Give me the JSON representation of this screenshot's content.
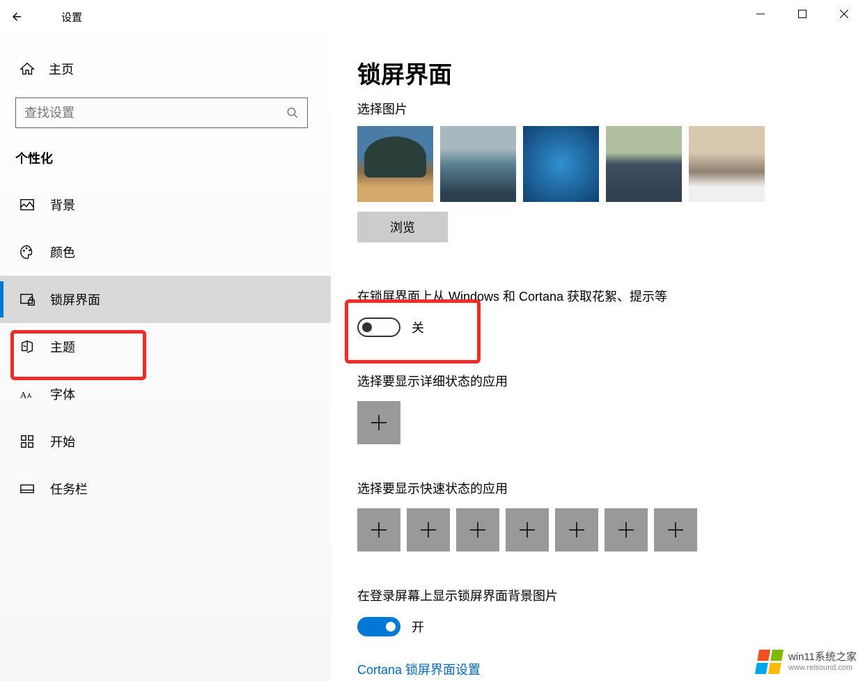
{
  "window": {
    "title": "设置"
  },
  "sidebar": {
    "home_label": "主页",
    "search_placeholder": "查找设置",
    "section_header": "个性化",
    "items": [
      {
        "label": "背景"
      },
      {
        "label": "颜色"
      },
      {
        "label": "锁屏界面"
      },
      {
        "label": "主题"
      },
      {
        "label": "字体"
      },
      {
        "label": "开始"
      },
      {
        "label": "任务栏"
      }
    ]
  },
  "content": {
    "page_title": "锁屏界面",
    "select_picture_label": "选择图片",
    "browse_label": "浏览",
    "tips_label": "在锁屏界面上从 Windows 和 Cortana 获取花絮、提示等",
    "tips_toggle_state": "关",
    "detail_app_label": "选择要显示详细状态的应用",
    "quick_app_label": "选择要显示快速状态的应用",
    "quick_app_count": 7,
    "signin_bg_label": "在登录屏幕上显示锁屏界面背景图片",
    "signin_toggle_state": "开",
    "cortana_link": "Cortana 锁屏界面设置"
  },
  "watermark": {
    "title": "win11系统之家",
    "url": "www.relsound.com"
  }
}
